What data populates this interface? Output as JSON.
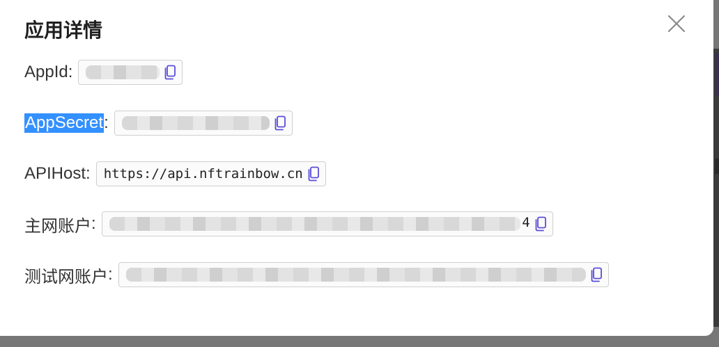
{
  "dialog": {
    "title": "应用详情"
  },
  "rows": [
    {
      "label": "AppId",
      "colon": ":",
      "value": "",
      "masked": true
    },
    {
      "label": "AppSecret",
      "colon": ":",
      "value": "",
      "masked": true
    },
    {
      "label": "APIHost",
      "colon": ":",
      "value": "https://api.nftrainbow.cn",
      "masked": false
    },
    {
      "label": "主网账户",
      "colon": ":",
      "value": "4",
      "masked": true
    },
    {
      "label": "测试网账户",
      "colon": ":",
      "value": "",
      "masked": true
    }
  ],
  "icons": {
    "close": "close-icon",
    "copy": "copy-icon"
  },
  "colors": {
    "accent": "#5b4dd6",
    "highlight": "#3390ff",
    "text": "#333333"
  }
}
